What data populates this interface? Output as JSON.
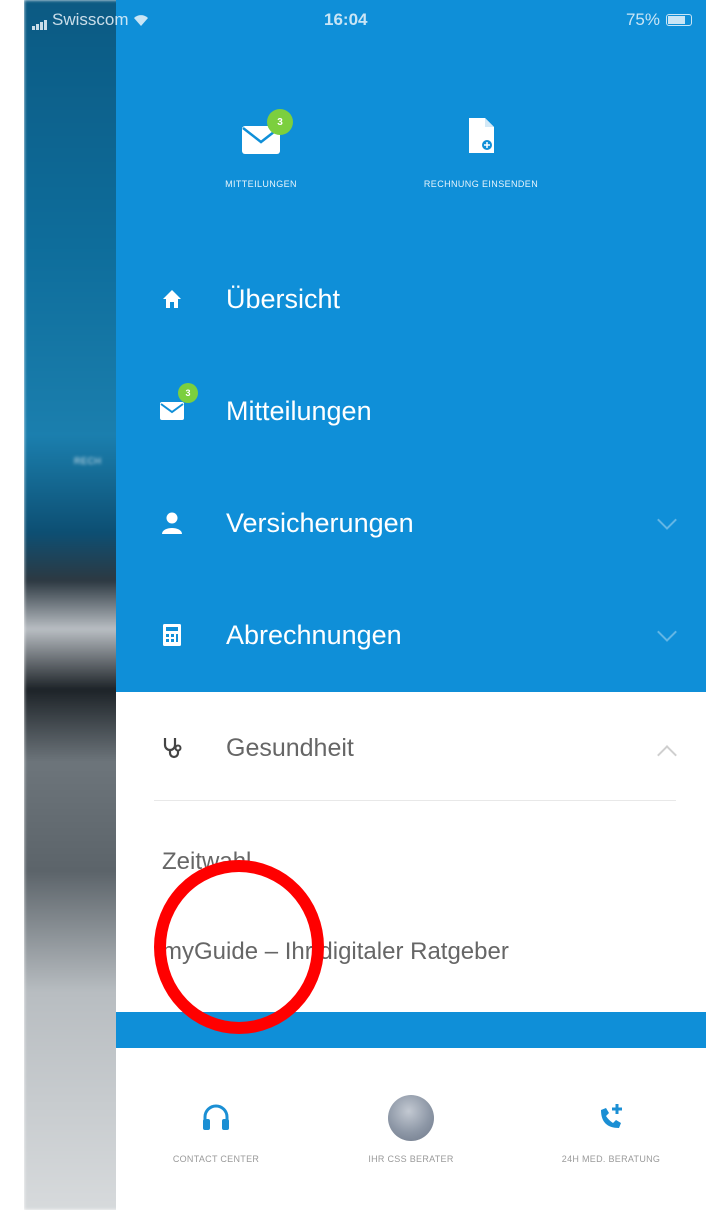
{
  "status_bar": {
    "carrier": "Swisscom",
    "time": "16:04",
    "battery": "75%"
  },
  "background_app": {
    "partial_label": "RECH"
  },
  "quick_actions": [
    {
      "label": "MITTEILUNGEN",
      "icon": "envelope-icon",
      "badge": "3"
    },
    {
      "label": "RECHNUNG EINSENDEN",
      "icon": "document-icon"
    }
  ],
  "menu": {
    "items": [
      {
        "label": "Übersicht",
        "icon": "home-icon"
      },
      {
        "label": "Mitteilungen",
        "icon": "envelope-icon",
        "badge": "3"
      },
      {
        "label": "Versicherungen",
        "icon": "person-icon"
      },
      {
        "label": "Abrechnungen",
        "icon": "calculator-icon"
      }
    ],
    "health": {
      "label": "Gesundheit",
      "icon": "stethoscope-icon",
      "sub_items": [
        {
          "label": "Zeitwahl"
        },
        {
          "label": "myGuide – Ihr digitaler Ratgeber"
        }
      ]
    }
  },
  "bottom_bar": [
    {
      "label": "CONTACT CENTER",
      "icon": "headset-icon"
    },
    {
      "label": "IHR CSS BERATER",
      "icon": "avatar"
    },
    {
      "label": "24H MED. BERATUNG",
      "icon": "phone-plus-icon"
    }
  ],
  "colors": {
    "primary_blue": "#0f8fd8",
    "badge_green": "#7ccf3e",
    "annotation_red": "#ff0000"
  }
}
